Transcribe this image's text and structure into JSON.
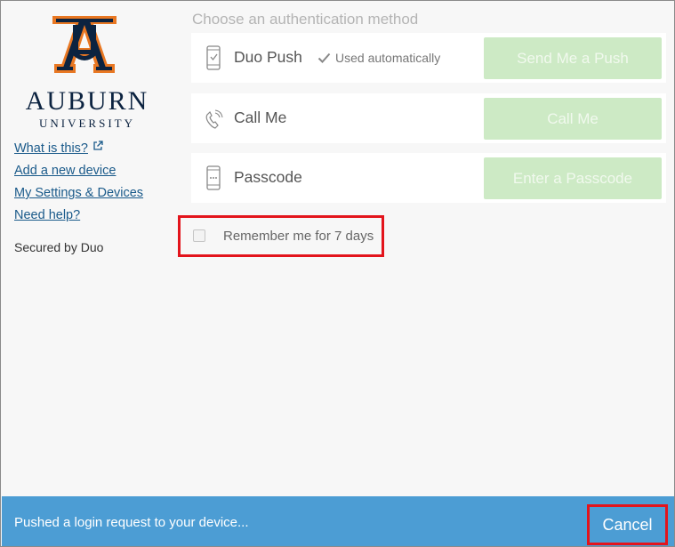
{
  "brand": {
    "name": "AUBURN",
    "subtitle": "UNIVERSITY",
    "logo_icon": "auburn-au-logo",
    "navy": "#0c2340",
    "orange": "#e87722"
  },
  "sidebar": {
    "links": [
      {
        "label": "What is this?",
        "icon": "external-link-icon"
      },
      {
        "label": "Add a new device"
      },
      {
        "label": "My Settings & Devices"
      },
      {
        "label": "Need help?"
      }
    ],
    "secured_by": "Secured by Duo"
  },
  "main": {
    "heading": "Choose an authentication method",
    "methods": [
      {
        "label": "Duo Push",
        "icon": "phone-check-icon",
        "note": "Used automatically",
        "note_icon": "checkmark-icon",
        "button": "Send Me a Push"
      },
      {
        "label": "Call Me",
        "icon": "phone-call-icon",
        "button": "Call Me"
      },
      {
        "label": "Passcode",
        "icon": "passcode-phone-icon",
        "button": "Enter a Passcode"
      }
    ],
    "remember": {
      "label": "Remember me for 7 days",
      "checked": false
    }
  },
  "footer": {
    "message": "Pushed a login request to your device...",
    "cancel_label": "Cancel",
    "background": "#4c9dd4"
  },
  "colors": {
    "button_bg": "#cdeac5",
    "highlight_border": "#e3141c"
  }
}
